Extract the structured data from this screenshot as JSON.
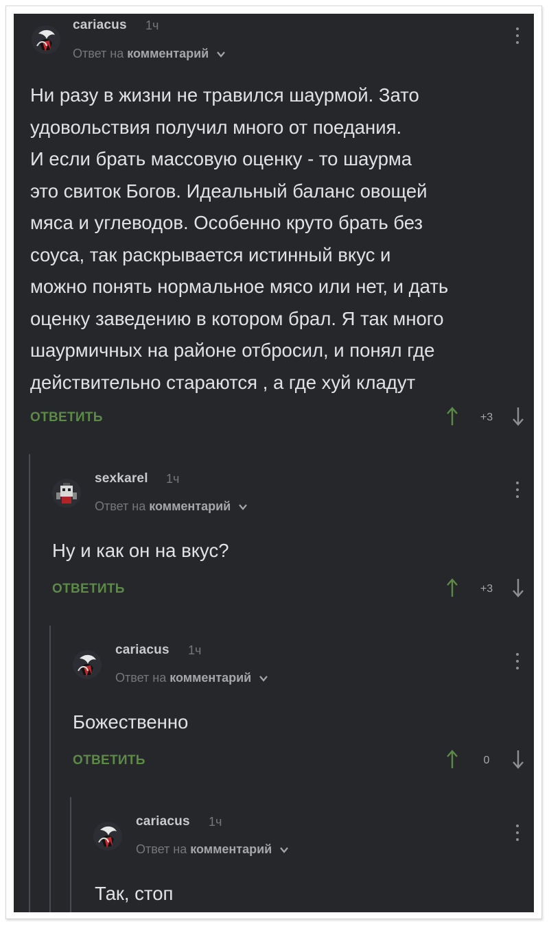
{
  "comments": [
    {
      "author": "cariacus",
      "time": "1ч",
      "reply_prefix": "Ответ на",
      "reply_target": "комментарий",
      "text": "Ни разу в жизни не травился шаурмой. Зато\nудовольствия получил много от поедания.\nИ если брать массовую оценку - то шаурма\nэто свиток Богов. Идеальный баланс овощей\nмяса и углеводов. Особенно круто брать без\nсоуса, так раскрывается истинный вкус и\nможно понять нормальное мясо или нет, и дать\nоценку заведению в котором брал. Я так много\nшаурмичных на районе отбросил, и понял где\nдействительно стараются , а где хуй кладут",
      "reply_label": "ОТВЕТИТЬ",
      "score": "+3"
    },
    {
      "author": "sexkarel",
      "time": "1ч",
      "reply_prefix": "Ответ на",
      "reply_target": "комментарий",
      "text": "Ну и как он на вкус?",
      "reply_label": "ОТВЕТИТЬ",
      "score": "+3"
    },
    {
      "author": "cariacus",
      "time": "1ч",
      "reply_prefix": "Ответ на",
      "reply_target": "комментарий",
      "text": "Божественно",
      "reply_label": "ОТВЕТИТЬ",
      "score": "0"
    },
    {
      "author": "cariacus",
      "time": "1ч",
      "reply_prefix": "Ответ на",
      "reply_target": "комментарий",
      "text": "Так, стоп"
    }
  ],
  "icons": {
    "avatar": "avatar-icon",
    "menu": "more-vertical-icon",
    "upvote": "arrow-up-icon",
    "downvote": "arrow-down-icon",
    "chevron": "chevron-down-icon"
  },
  "colors": {
    "background": "#26272b",
    "reply_button": "#5c8a47",
    "upvote": "#5c8a47",
    "text": "#e1e2e4",
    "muted": "#76777b"
  }
}
